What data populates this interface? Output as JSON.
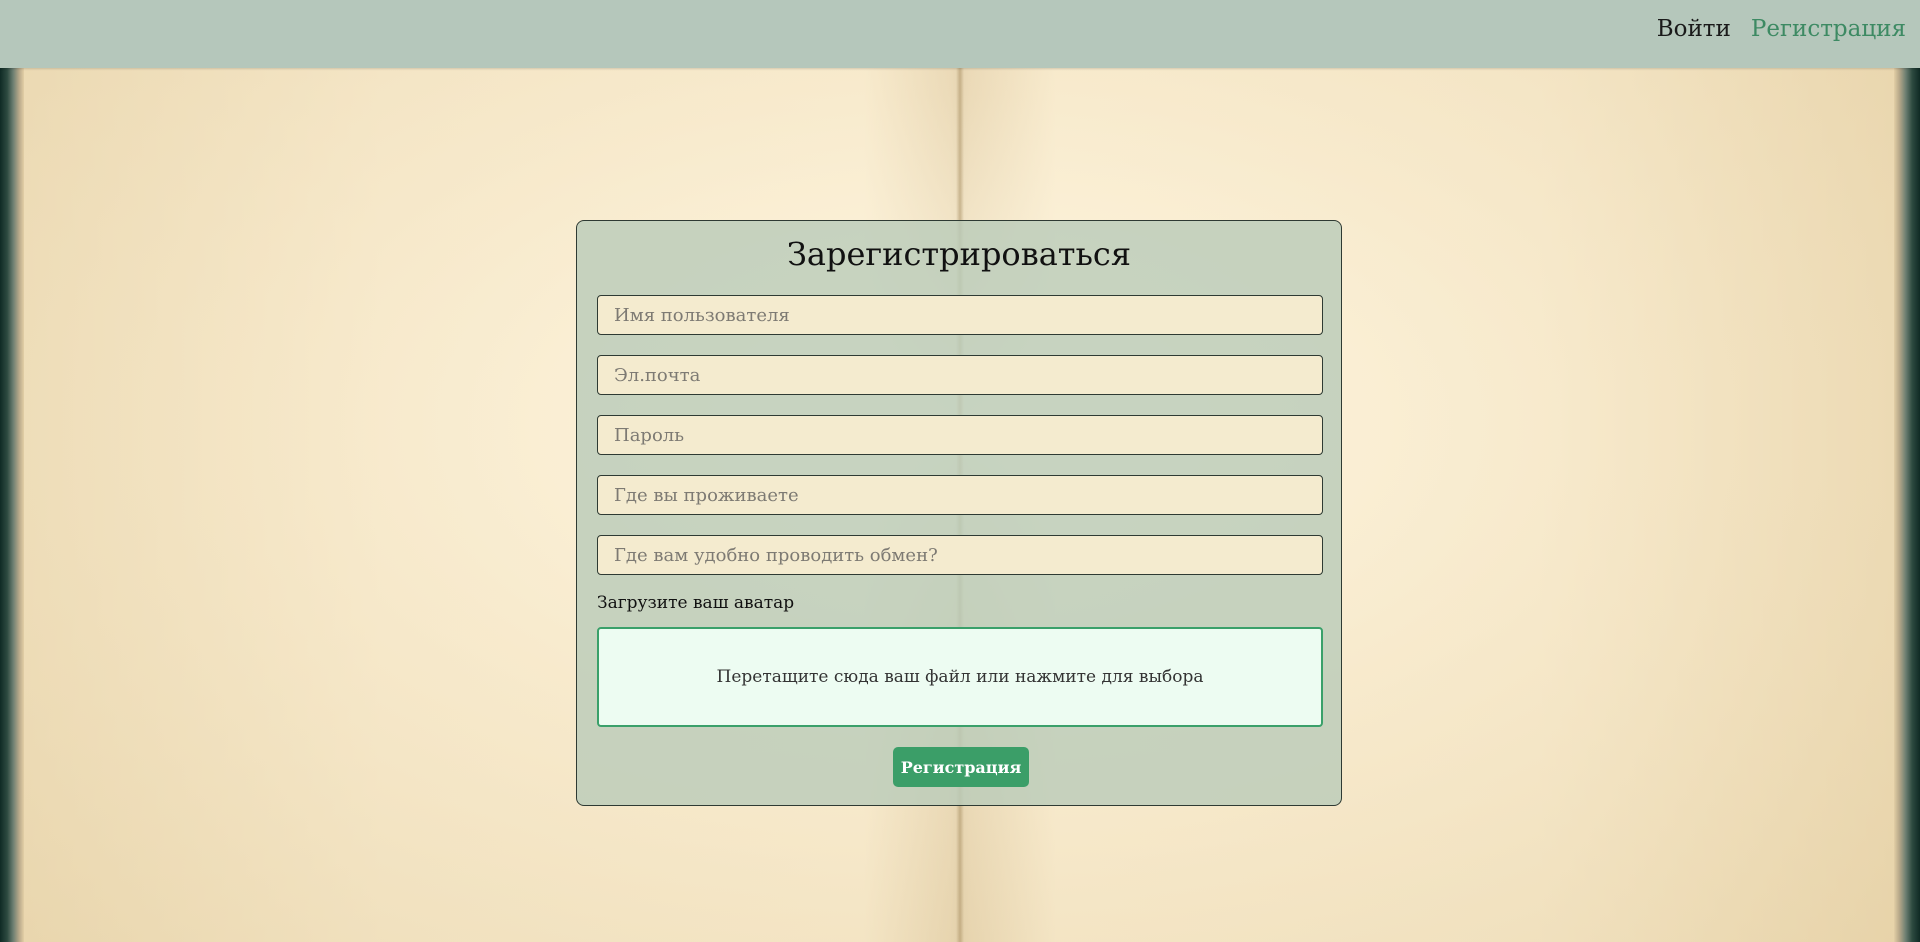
{
  "nav": {
    "login_label": "Войти",
    "register_label": "Регистрация"
  },
  "form": {
    "title": "Зарегистрироваться",
    "fields": [
      {
        "placeholder": "Имя пользователя",
        "value": ""
      },
      {
        "placeholder": "Эл.почта",
        "value": ""
      },
      {
        "placeholder": "Пароль",
        "value": ""
      },
      {
        "placeholder": "Где вы проживаете",
        "value": ""
      },
      {
        "placeholder": "Где вам удобно проводить обмен?",
        "value": ""
      }
    ],
    "avatar_label": "Загрузите ваш аватар",
    "dropzone_text": "Перетащите сюда ваш файл или нажмите для выбора",
    "submit_label": "Регистрация"
  },
  "colors": {
    "topbar": "#b5c7bb",
    "accent_green": "#3b9e68",
    "nav_register": "#3d8a63",
    "input_bg": "#f4ebcf",
    "dropzone_bg": "#edfcf2"
  }
}
